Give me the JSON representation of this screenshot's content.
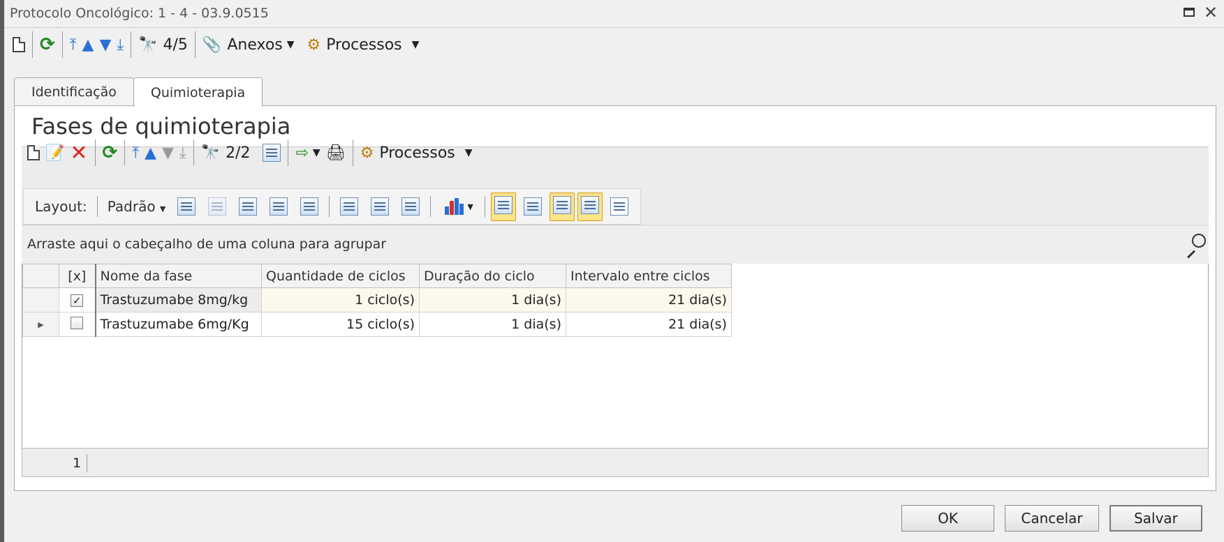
{
  "window": {
    "title": "Protocolo Oncológico: 1 - 4 - 03.9.0515",
    "maximize_icon": "maximize-icon",
    "close_glyph": "✕"
  },
  "main_toolbar": {
    "record_counter": "4/5",
    "annexes_label": "Anexos",
    "processes_label": "Processos"
  },
  "tabs": [
    {
      "label": "Identificação",
      "active": false
    },
    {
      "label": "Quimioterapia",
      "active": true
    }
  ],
  "section": {
    "title": "Fases de quimioterapia"
  },
  "grid_toolbar": {
    "record_counter": "2/2",
    "processes_label": "Processos"
  },
  "layout_bar": {
    "layout_label": "Layout:",
    "layout_value": "Padrão"
  },
  "grid": {
    "group_hint": "Arraste aqui o cabeçalho de uma coluna para agrupar",
    "columns": [
      "[x]",
      "Nome da fase",
      "Quantidade de ciclos",
      "Duração do ciclo",
      "Intervalo entre ciclos"
    ],
    "rows": [
      {
        "checked": true,
        "name": "Trastuzumabe 8mg/kg",
        "cycles": "1 ciclo(s)",
        "duration": "1 dia(s)",
        "interval": "21 dia(s)",
        "current": false
      },
      {
        "checked": false,
        "name": "Trastuzumabe 6mg/Kg",
        "cycles": "15 ciclo(s)",
        "duration": "1 dia(s)",
        "interval": "21 dia(s)",
        "current": true
      }
    ],
    "footer_count": "1"
  },
  "buttons": {
    "ok": "OK",
    "cancel": "Cancelar",
    "save": "Salvar"
  },
  "colors": {
    "highlight_bg": "#fde38a",
    "refresh_green": "#1e8a1e",
    "delete_red": "#e0241b",
    "nav_blue": "#2a6fd6"
  }
}
